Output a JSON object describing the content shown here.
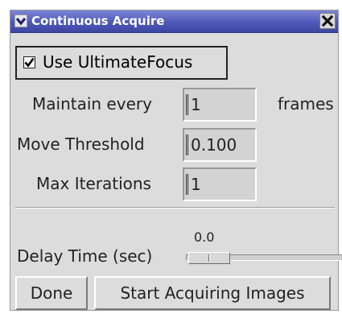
{
  "window": {
    "title": "Continuous Acquire",
    "titlebar_color": "#4e58b6",
    "menu_icon": "chevron-down-icon",
    "close_icon": "close-icon"
  },
  "use_focus": {
    "label": "Use UltimateFocus",
    "checked": true
  },
  "maintain": {
    "label": "Maintain every",
    "value": "1",
    "suffix": "frames"
  },
  "threshold": {
    "label": "Move Threshold",
    "value": "0.100"
  },
  "iterations": {
    "label": "Max Iterations",
    "value": "1"
  },
  "delay": {
    "label": "Delay Time (sec)",
    "value": "0.0"
  },
  "buttons": {
    "done": "Done",
    "start": "Start Acquiring Images"
  }
}
